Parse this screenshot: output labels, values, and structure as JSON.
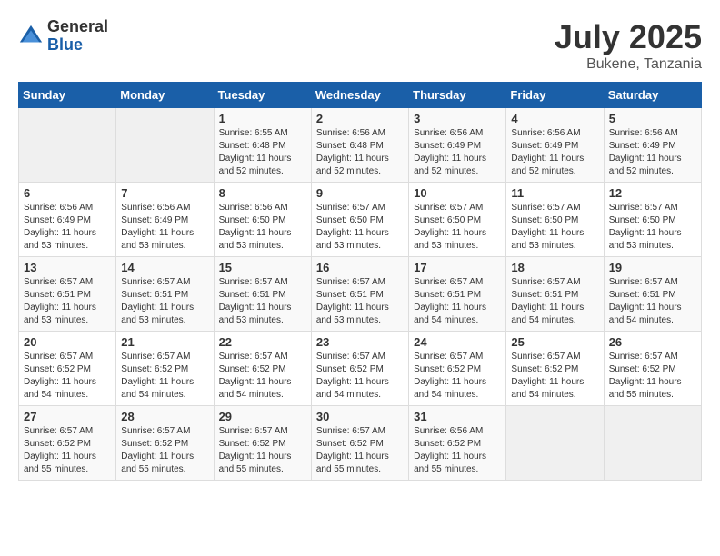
{
  "header": {
    "logo_general": "General",
    "logo_blue": "Blue",
    "title": "July 2025",
    "location": "Bukene, Tanzania"
  },
  "days_of_week": [
    "Sunday",
    "Monday",
    "Tuesday",
    "Wednesday",
    "Thursday",
    "Friday",
    "Saturday"
  ],
  "weeks": [
    [
      {
        "day": "",
        "info": ""
      },
      {
        "day": "",
        "info": ""
      },
      {
        "day": "1",
        "info": "Sunrise: 6:55 AM\nSunset: 6:48 PM\nDaylight: 11 hours and 52 minutes."
      },
      {
        "day": "2",
        "info": "Sunrise: 6:56 AM\nSunset: 6:48 PM\nDaylight: 11 hours and 52 minutes."
      },
      {
        "day": "3",
        "info": "Sunrise: 6:56 AM\nSunset: 6:49 PM\nDaylight: 11 hours and 52 minutes."
      },
      {
        "day": "4",
        "info": "Sunrise: 6:56 AM\nSunset: 6:49 PM\nDaylight: 11 hours and 52 minutes."
      },
      {
        "day": "5",
        "info": "Sunrise: 6:56 AM\nSunset: 6:49 PM\nDaylight: 11 hours and 52 minutes."
      }
    ],
    [
      {
        "day": "6",
        "info": "Sunrise: 6:56 AM\nSunset: 6:49 PM\nDaylight: 11 hours and 53 minutes."
      },
      {
        "day": "7",
        "info": "Sunrise: 6:56 AM\nSunset: 6:49 PM\nDaylight: 11 hours and 53 minutes."
      },
      {
        "day": "8",
        "info": "Sunrise: 6:56 AM\nSunset: 6:50 PM\nDaylight: 11 hours and 53 minutes."
      },
      {
        "day": "9",
        "info": "Sunrise: 6:57 AM\nSunset: 6:50 PM\nDaylight: 11 hours and 53 minutes."
      },
      {
        "day": "10",
        "info": "Sunrise: 6:57 AM\nSunset: 6:50 PM\nDaylight: 11 hours and 53 minutes."
      },
      {
        "day": "11",
        "info": "Sunrise: 6:57 AM\nSunset: 6:50 PM\nDaylight: 11 hours and 53 minutes."
      },
      {
        "day": "12",
        "info": "Sunrise: 6:57 AM\nSunset: 6:50 PM\nDaylight: 11 hours and 53 minutes."
      }
    ],
    [
      {
        "day": "13",
        "info": "Sunrise: 6:57 AM\nSunset: 6:51 PM\nDaylight: 11 hours and 53 minutes."
      },
      {
        "day": "14",
        "info": "Sunrise: 6:57 AM\nSunset: 6:51 PM\nDaylight: 11 hours and 53 minutes."
      },
      {
        "day": "15",
        "info": "Sunrise: 6:57 AM\nSunset: 6:51 PM\nDaylight: 11 hours and 53 minutes."
      },
      {
        "day": "16",
        "info": "Sunrise: 6:57 AM\nSunset: 6:51 PM\nDaylight: 11 hours and 53 minutes."
      },
      {
        "day": "17",
        "info": "Sunrise: 6:57 AM\nSunset: 6:51 PM\nDaylight: 11 hours and 54 minutes."
      },
      {
        "day": "18",
        "info": "Sunrise: 6:57 AM\nSunset: 6:51 PM\nDaylight: 11 hours and 54 minutes."
      },
      {
        "day": "19",
        "info": "Sunrise: 6:57 AM\nSunset: 6:51 PM\nDaylight: 11 hours and 54 minutes."
      }
    ],
    [
      {
        "day": "20",
        "info": "Sunrise: 6:57 AM\nSunset: 6:52 PM\nDaylight: 11 hours and 54 minutes."
      },
      {
        "day": "21",
        "info": "Sunrise: 6:57 AM\nSunset: 6:52 PM\nDaylight: 11 hours and 54 minutes."
      },
      {
        "day": "22",
        "info": "Sunrise: 6:57 AM\nSunset: 6:52 PM\nDaylight: 11 hours and 54 minutes."
      },
      {
        "day": "23",
        "info": "Sunrise: 6:57 AM\nSunset: 6:52 PM\nDaylight: 11 hours and 54 minutes."
      },
      {
        "day": "24",
        "info": "Sunrise: 6:57 AM\nSunset: 6:52 PM\nDaylight: 11 hours and 54 minutes."
      },
      {
        "day": "25",
        "info": "Sunrise: 6:57 AM\nSunset: 6:52 PM\nDaylight: 11 hours and 54 minutes."
      },
      {
        "day": "26",
        "info": "Sunrise: 6:57 AM\nSunset: 6:52 PM\nDaylight: 11 hours and 55 minutes."
      }
    ],
    [
      {
        "day": "27",
        "info": "Sunrise: 6:57 AM\nSunset: 6:52 PM\nDaylight: 11 hours and 55 minutes."
      },
      {
        "day": "28",
        "info": "Sunrise: 6:57 AM\nSunset: 6:52 PM\nDaylight: 11 hours and 55 minutes."
      },
      {
        "day": "29",
        "info": "Sunrise: 6:57 AM\nSunset: 6:52 PM\nDaylight: 11 hours and 55 minutes."
      },
      {
        "day": "30",
        "info": "Sunrise: 6:57 AM\nSunset: 6:52 PM\nDaylight: 11 hours and 55 minutes."
      },
      {
        "day": "31",
        "info": "Sunrise: 6:56 AM\nSunset: 6:52 PM\nDaylight: 11 hours and 55 minutes."
      },
      {
        "day": "",
        "info": ""
      },
      {
        "day": "",
        "info": ""
      }
    ]
  ]
}
